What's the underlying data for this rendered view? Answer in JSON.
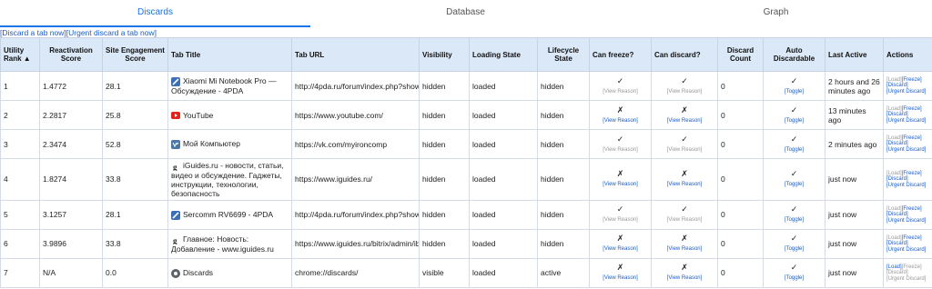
{
  "tabs": [
    "Discards",
    "Database",
    "Graph"
  ],
  "top_actions": {
    "discard": "[Discard a tab now]",
    "urgent": "[Urgent discard a tab now]"
  },
  "columns": {
    "rank": "Utility Rank ▲",
    "reactivation": "Reactivation Score",
    "engagement": "Site Engagement Score",
    "title": "Tab Title",
    "url": "Tab URL",
    "visibility": "Visibility",
    "loading": "Loading State",
    "lifecycle": "Lifecycle State",
    "freeze": "Can freeze?",
    "discard": "Can discard?",
    "count": "Discard Count",
    "auto": "Auto Discardable",
    "last": "Last Active",
    "actions": "Actions"
  },
  "labels": {
    "view_reason": "[View Reason]",
    "toggle": "[Toggle]",
    "load": "[Load]",
    "freeze": "[Freeze]",
    "discard": "[Discard]",
    "urgent": "[Urgent Discard]"
  },
  "rows": [
    {
      "rank": "1",
      "reactivation": "1.4772",
      "engagement": "28.1",
      "title": "Xiaomi Mi Notebook Pro — Обсуждение - 4PDA",
      "url": "http://4pda.ru/forum/index.php?showtopic",
      "visibility": "hidden",
      "loading": "loaded",
      "lifecycle": "hidden",
      "freeze": "✓",
      "discard": "✓",
      "count": "0",
      "auto": "✓",
      "last": "2 hours and 26 minutes ago",
      "icon": "4pda"
    },
    {
      "rank": "2",
      "reactivation": "2.2817",
      "engagement": "25.8",
      "title": "YouTube",
      "url": "https://www.youtube.com/",
      "visibility": "hidden",
      "loading": "loaded",
      "lifecycle": "hidden",
      "freeze": "✗",
      "discard": "✗",
      "count": "0",
      "auto": "✓",
      "last": "13 minutes ago",
      "icon": "youtube"
    },
    {
      "rank": "3",
      "reactivation": "2.3474",
      "engagement": "52.8",
      "title": "Мой Компьютер",
      "url": "https://vk.com/myironcomp",
      "visibility": "hidden",
      "loading": "loaded",
      "lifecycle": "hidden",
      "freeze": "✓",
      "discard": "✓",
      "count": "0",
      "auto": "✓",
      "last": "2 minutes ago",
      "icon": "vk"
    },
    {
      "rank": "4",
      "reactivation": "1.8274",
      "engagement": "33.8",
      "title": "iGuides.ru - новости, статьи, видео и обсуждение. Гаджеты, инструкции, технологии, безопасность",
      "url": "https://www.iguides.ru/",
      "visibility": "hidden",
      "loading": "loaded",
      "lifecycle": "hidden",
      "freeze": "✗",
      "discard": "✗",
      "count": "0",
      "auto": "✓",
      "last": "just now",
      "icon": "iguides"
    },
    {
      "rank": "5",
      "reactivation": "3.1257",
      "engagement": "28.1",
      "title": "Sercomm RV6699 - 4PDA",
      "url": "http://4pda.ru/forum/index.php?showtopic",
      "visibility": "hidden",
      "loading": "loaded",
      "lifecycle": "hidden",
      "freeze": "✓",
      "discard": "✓",
      "count": "0",
      "auto": "✓",
      "last": "just now",
      "icon": "4pda"
    },
    {
      "rank": "6",
      "reactivation": "3.9896",
      "engagement": "33.8",
      "title": "Главное: Новость: Добавление - www.iguides.ru",
      "url": "https://www.iguides.ru/bitrix/admin/iblock",
      "visibility": "hidden",
      "loading": "loaded",
      "lifecycle": "hidden",
      "freeze": "✗",
      "discard": "✗",
      "count": "0",
      "auto": "✓",
      "last": "just now",
      "icon": "iguides"
    },
    {
      "rank": "7",
      "reactivation": "N/A",
      "engagement": "0.0",
      "title": "Discards",
      "url": "chrome://discards/",
      "visibility": "visible",
      "loading": "loaded",
      "lifecycle": "active",
      "freeze": "✗",
      "discard": "✗",
      "count": "0",
      "auto": "✓",
      "last": "just now",
      "icon": "chrome"
    }
  ]
}
